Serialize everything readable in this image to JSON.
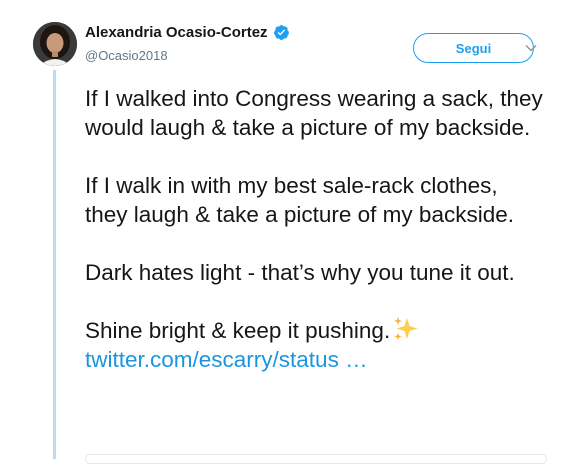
{
  "author": {
    "display_name": "Alexandria Ocasio-Cortez",
    "handle": "@Ocasio2018",
    "verified": true
  },
  "follow_button": {
    "label": "Segui"
  },
  "tweet": {
    "paragraphs": [
      "If I walked into Congress wearing a sack, they would laugh & take a picture of my backside.",
      "If I walk in with my best sale-rack clothes, they laugh & take a picture of my backside.",
      "Dark hates light - that’s why you tune it out."
    ],
    "last_line": "Shine bright & keep it pushing.",
    "link_text": "twitter.com/escarry/status …"
  },
  "icons": {
    "verified": "verified-badge-icon",
    "menu": "chevron-down-icon",
    "emoji": "sparkles-icon"
  },
  "colors": {
    "accent": "#1da1f2",
    "link": "#1b95e0",
    "thread_line": "#b8dcf5",
    "text": "#14171a",
    "secondary_text": "#657786"
  }
}
